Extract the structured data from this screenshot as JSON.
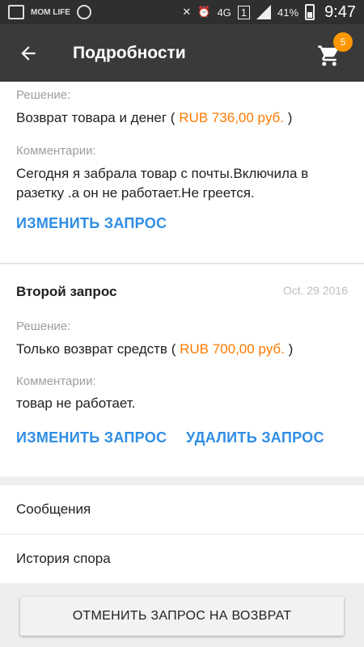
{
  "status_bar": {
    "left_icons": [
      "gallery-icon",
      "mom-life-icon",
      "app-icon"
    ],
    "left_label": "MOM LIFE",
    "network": "4G",
    "sim": "1",
    "battery": "41%",
    "time": "9:47"
  },
  "app_bar": {
    "title": "Подробности",
    "cart_count": "5"
  },
  "first_request": {
    "decision_label": "Решение:",
    "decision_text_before": "Возврат товара и денег (",
    "decision_price": "RUB 736,00 руб.",
    "decision_text_after": ")",
    "comment_label": "Комментарии:",
    "comment_text": "Сегодня я забрала товар с почты.Включила в разетку .а он не работает.Не греется.",
    "edit_link": "ИЗМЕНИТЬ ЗАПРОС"
  },
  "second_request": {
    "title": "Второй запрос",
    "date": "Oct. 29 2016",
    "decision_label": "Решение:",
    "decision_text_before": "Только возврат средств (",
    "decision_price": "RUB 700,00 руб.",
    "decision_text_after": ")",
    "comment_label": "Комментарии:",
    "comment_text": "товар не работает.",
    "edit_link": "ИЗМЕНИТЬ ЗАПРОС",
    "delete_link": "УДАЛИТЬ ЗАПРОС"
  },
  "list": {
    "messages": "Сообщения",
    "history": "История спора"
  },
  "bottom_button": "ОТМЕНИТЬ ЗАПРОС НА ВОЗВРАТ",
  "colors": {
    "accent_link": "#2f8de4",
    "price": "#ff7a00",
    "badge": "#ff9800",
    "app_bar": "#3a3a3a"
  }
}
